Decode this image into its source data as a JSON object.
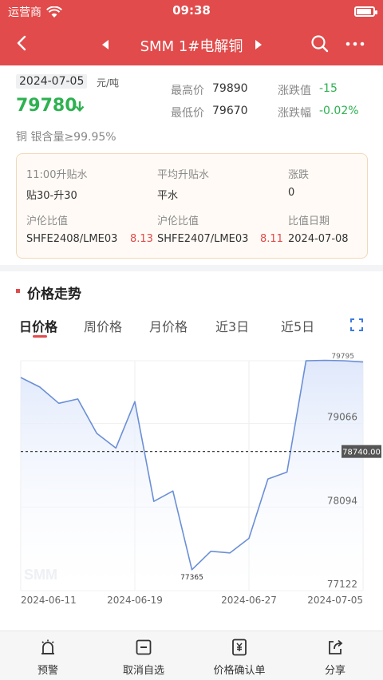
{
  "status": {
    "carrier": "运营商",
    "time": "09:38",
    "battery_level": 0.9
  },
  "header": {
    "title": "SMM 1#电解铜"
  },
  "quote": {
    "date": "2024-07-05",
    "unit": "元/吨",
    "price": "79780",
    "purity": "铜 银含量≥99.95%",
    "high_label": "最高价",
    "high_value": "79890",
    "low_label": "最低价",
    "low_value": "79670",
    "change_label": "涨跌值",
    "change_value": "-15",
    "pct_label": "涨跌幅",
    "pct_value": "-0.02%"
  },
  "info": {
    "premium_label": "11:00升贴水",
    "premium_value": "贴30-升30",
    "avg_label": "平均升贴水",
    "avg_value": "平水",
    "chg_label": "涨跌",
    "chg_value": "0",
    "ratio1_label": "沪伦比值",
    "ratio1_contract": "SHFE2408/LME03",
    "ratio1_value": "8.13",
    "ratio2_label": "沪伦比值",
    "ratio2_contract": "SHFE2407/LME03",
    "ratio2_value": "8.11",
    "ratio_date_label": "比值日期",
    "ratio_date_value": "2024-07-08"
  },
  "trend": {
    "title": "价格走势",
    "tabs": [
      "日价格",
      "周价格",
      "月价格",
      "近3日",
      "近5日"
    ],
    "active_tab": 0
  },
  "chart_data": {
    "type": "area",
    "x": [
      "2024-06-11",
      "2024-06-12",
      "2024-06-13",
      "2024-06-14",
      "2024-06-17",
      "2024-06-18",
      "2024-06-19",
      "2024-06-20",
      "2024-06-21",
      "2024-06-24",
      "2024-06-25",
      "2024-06-26",
      "2024-06-27",
      "2024-06-28",
      "2024-07-01",
      "2024-07-02",
      "2024-07-03",
      "2024-07-04",
      "2024-07-05"
    ],
    "values": [
      79600,
      79490,
      79300,
      79350,
      78950,
      78780,
      79320,
      78160,
      78280,
      77365,
      77580,
      77560,
      77730,
      78420,
      78500,
      79795,
      79800,
      79795,
      79780
    ],
    "ylim": [
      77122,
      79795
    ],
    "y_ticks": [
      "79795",
      "79066",
      "78094",
      "77122"
    ],
    "x_ticks": [
      "2024-06-11",
      "2024-06-19",
      "2024-06-27",
      "2024-07-05"
    ],
    "reference_value": 78740.0,
    "reference_label": "78740.00",
    "min_label": "77365",
    "watermark": "SMM",
    "line_color": "#6b8fd6",
    "fill_color": "#dfe8fb"
  },
  "toolbar": {
    "alert": "预警",
    "unfollow": "取消自选",
    "confirm": "价格确认单",
    "share": "分享"
  },
  "colors": {
    "brand_red": "#e14b4b",
    "up_green": "#2eb150"
  }
}
